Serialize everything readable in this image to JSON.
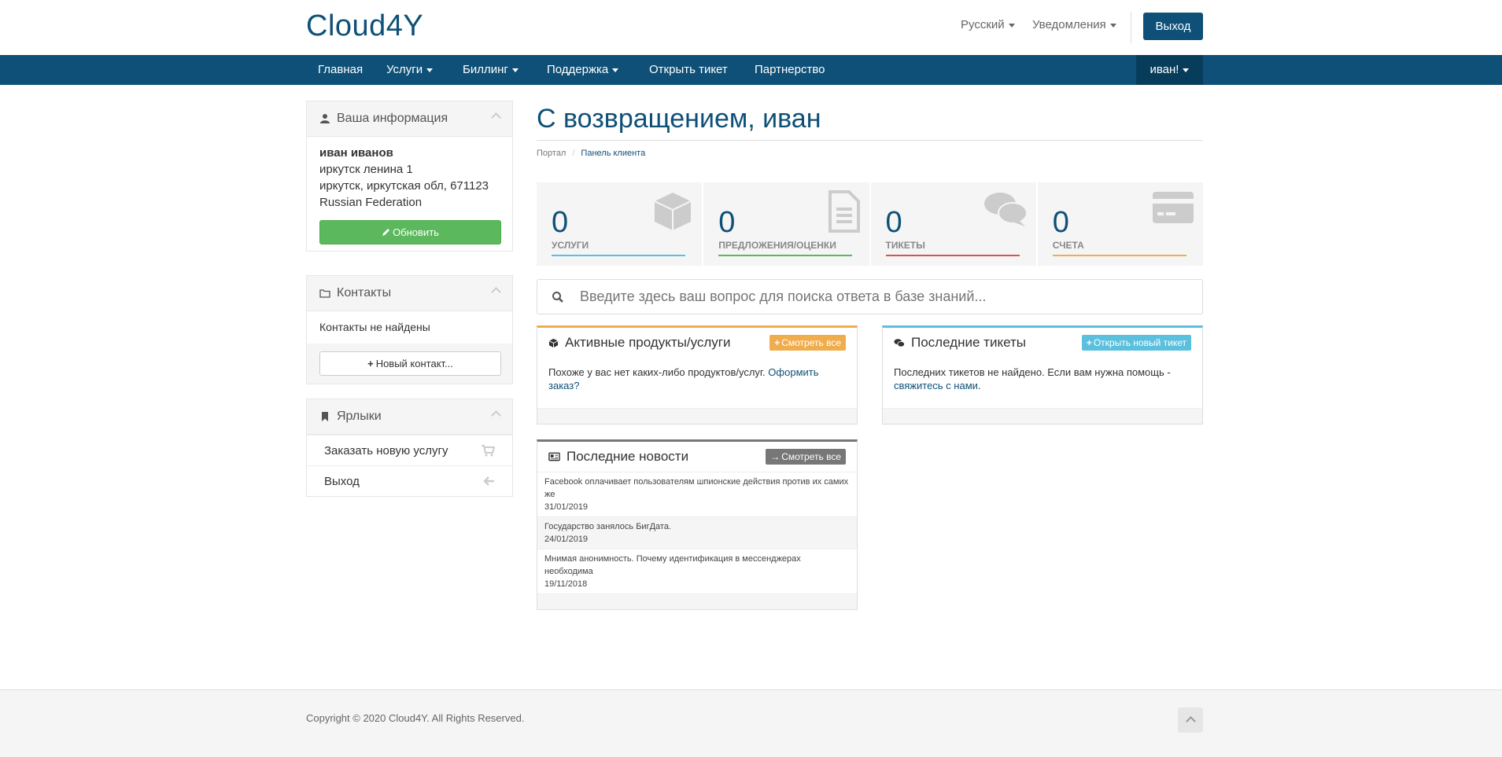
{
  "header": {
    "logo": "Cloud4Y",
    "language": "Русский",
    "notifications": "Уведомления",
    "logout": "Выход"
  },
  "nav": {
    "items": [
      {
        "label": "Главная",
        "dropdown": false
      },
      {
        "label": "Услуги",
        "dropdown": true
      },
      {
        "label": "Биллинг",
        "dropdown": true
      },
      {
        "label": "Поддержка",
        "dropdown": true
      },
      {
        "label": "Открыть тикет",
        "dropdown": false
      },
      {
        "label": "Партнерство",
        "dropdown": false
      }
    ],
    "user": "иван!"
  },
  "sidebar": {
    "info": {
      "title": "Ваша информация",
      "name": "иван иванов",
      "address1": "иркутск ленина 1",
      "address2": "иркутск, иркутская обл, 671123",
      "country": "Russian Federation",
      "update_button": "Обновить"
    },
    "contacts": {
      "title": "Контакты",
      "empty": "Контакты не найдены",
      "new_button": "Новый контакт..."
    },
    "shortcuts": {
      "title": "Ярлыки",
      "items": [
        {
          "label": "Заказать новую услугу",
          "icon": "cart-icon"
        },
        {
          "label": "Выход",
          "icon": "arrow-left-icon"
        }
      ]
    }
  },
  "main": {
    "title": "С возвращением, иван",
    "breadcrumb": [
      "Портал",
      "Панель клиента"
    ],
    "tiles": [
      {
        "value": "0",
        "label": "УСЛУГИ",
        "color": "#5bc0de",
        "icon": "cube-icon"
      },
      {
        "value": "0",
        "label": "ПРЕДЛОЖЕНИЯ/ОЦЕНКИ",
        "color": "#5cb85c",
        "icon": "document-icon"
      },
      {
        "value": "0",
        "label": "ТИКЕТЫ",
        "color": "#d9534f",
        "icon": "comments-icon"
      },
      {
        "value": "0",
        "label": "СЧЕТА",
        "color": "#f0ad4e",
        "icon": "credit-card-icon"
      }
    ],
    "search_placeholder": "Введите здесь ваш вопрос для поиска ответа в базе знаний...",
    "products": {
      "title": "Активные продукты/услуги",
      "button": "Смотреть все",
      "text": "Похоже у вас нет каких-либо продуктов/услуг. ",
      "link": "Оформить заказ",
      "tail": "?"
    },
    "tickets": {
      "title": "Последние тикеты",
      "button": "Открыть новый тикет",
      "text": "Последних тикетов не найдено. Если вам нужна помощь - ",
      "link": "свяжитесь с нами",
      "tail": "."
    },
    "news": {
      "title": "Последние новости",
      "button": "Смотреть все",
      "items": [
        {
          "headline": "Facebook оплачивает пользователям шпионские действия против их самих же",
          "date": "31/01/2019"
        },
        {
          "headline": "Государство занялось БигДата.",
          "date": "24/01/2019"
        },
        {
          "headline": "Мнимая анонимность. Почему идентификация в мессенджерах необходима",
          "date": "19/11/2018"
        }
      ]
    }
  },
  "footer": {
    "copyright": "Copyright © 2020 Cloud4Y. All Rights Reserved."
  }
}
